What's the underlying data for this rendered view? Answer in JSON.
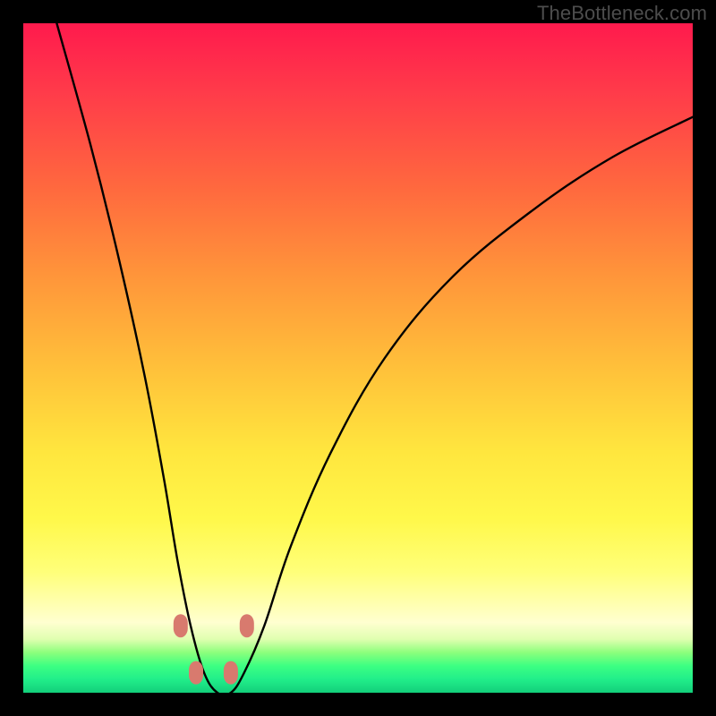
{
  "watermark": "TheBottleneck.com",
  "colors": {
    "page_bg": "#000000",
    "watermark": "#4d4d4d",
    "curve_stroke": "#000000",
    "marker_fill": "#d87a6e",
    "gradient_stops": [
      {
        "offset": 0.0,
        "color": "#ff1a4d"
      },
      {
        "offset": 0.1,
        "color": "#ff3a4a"
      },
      {
        "offset": 0.25,
        "color": "#ff6a3e"
      },
      {
        "offset": 0.38,
        "color": "#ff963a"
      },
      {
        "offset": 0.52,
        "color": "#ffc23a"
      },
      {
        "offset": 0.64,
        "color": "#ffe63e"
      },
      {
        "offset": 0.74,
        "color": "#fff84a"
      },
      {
        "offset": 0.82,
        "color": "#ffff7a"
      },
      {
        "offset": 0.895,
        "color": "#ffffd0"
      },
      {
        "offset": 0.92,
        "color": "#e0ffb0"
      },
      {
        "offset": 0.94,
        "color": "#8cff7c"
      },
      {
        "offset": 0.96,
        "color": "#3cff82"
      },
      {
        "offset": 0.98,
        "color": "#21ee8a"
      },
      {
        "offset": 1.0,
        "color": "#13cf7a"
      }
    ]
  },
  "chart_data": {
    "type": "line",
    "title": "",
    "xlabel": "",
    "ylabel": "",
    "xlim": [
      0,
      100
    ],
    "ylim": [
      0,
      100
    ],
    "note": "x = horizontal position (0 left → 100 right inside gradient panel); y = bottleneck % (0 at bottom/green → 100 at top/red). Curve is a V-shaped bottleneck profile with minimum ~0 near x≈27–32.",
    "series": [
      {
        "name": "bottleneck_curve",
        "x": [
          5,
          10,
          14,
          18,
          21,
          23,
          25,
          27,
          29,
          31,
          33,
          36,
          40,
          46,
          54,
          64,
          76,
          88,
          100
        ],
        "y": [
          100,
          82,
          66,
          48,
          32,
          20,
          10,
          3,
          0,
          0,
          3,
          10,
          22,
          36,
          50,
          62,
          72,
          80,
          86
        ]
      }
    ],
    "markers": [
      {
        "x": 23.5,
        "y": 10
      },
      {
        "x": 25.8,
        "y": 3
      },
      {
        "x": 31.0,
        "y": 3
      },
      {
        "x": 33.4,
        "y": 10
      }
    ],
    "marker_shape": "rounded-rect",
    "background_meaning": "vertical gradient encodes y-axis value: red=high bottleneck, green=low"
  }
}
